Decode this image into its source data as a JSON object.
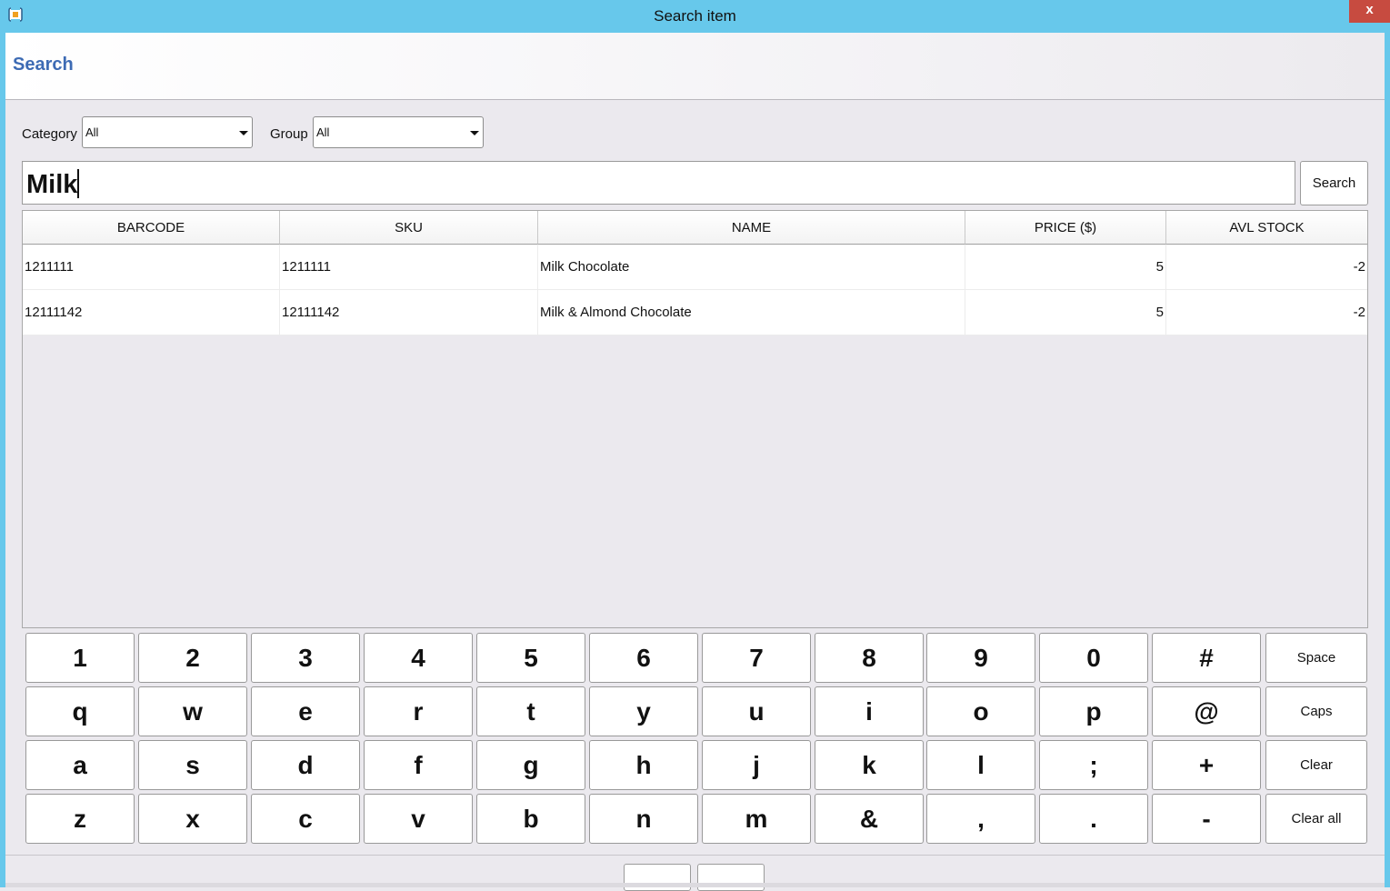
{
  "window": {
    "title": "Search item",
    "close_glyph": "x",
    "icon": "app-icon"
  },
  "header": {
    "title": "Search"
  },
  "filters": {
    "category_label": "Category",
    "category_value": "All",
    "group_label": "Group",
    "group_value": "All"
  },
  "search": {
    "value": "Milk",
    "button_label": "Search"
  },
  "table": {
    "columns": [
      "BARCODE",
      "SKU",
      "NAME",
      "PRICE ($)",
      "AVL STOCK"
    ],
    "rows": [
      [
        "1211111",
        "1211111",
        "Milk Chocolate",
        "5",
        "-2"
      ],
      [
        "12111142",
        "12111142",
        "Milk & Almond Chocolate",
        "5",
        "-2"
      ]
    ]
  },
  "keyboard": {
    "rows": [
      [
        "1",
        "2",
        "3",
        "4",
        "5",
        "6",
        "7",
        "8",
        "9",
        "0",
        "#"
      ],
      [
        "q",
        "w",
        "e",
        "r",
        "t",
        "y",
        "u",
        "i",
        "o",
        "p",
        "@"
      ],
      [
        "a",
        "s",
        "d",
        "f",
        "g",
        "h",
        "j",
        "k",
        "l",
        ";",
        "+"
      ],
      [
        "z",
        "x",
        "c",
        "v",
        "b",
        "n",
        "m",
        "&",
        ",",
        ".",
        "-"
      ]
    ],
    "function_keys": [
      "Space",
      "Caps",
      "Clear",
      "Clear all"
    ]
  },
  "colors": {
    "titlebar": "#67c8eb",
    "header_title": "#3d6bb4",
    "close_button": "#c74b40"
  }
}
